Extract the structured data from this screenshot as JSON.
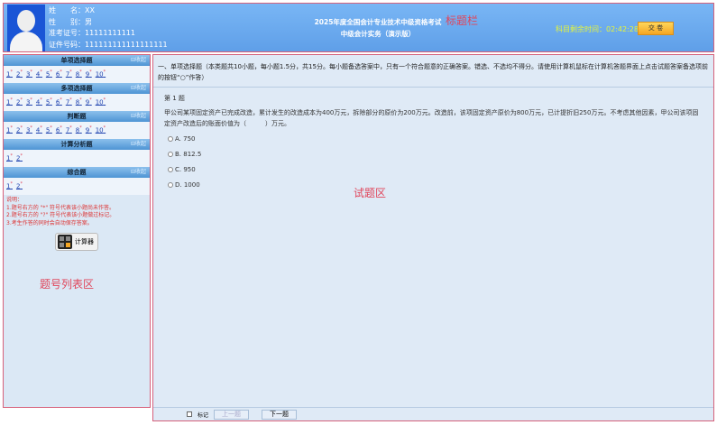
{
  "header": {
    "name_label": "姓　　名：",
    "name": "XX",
    "gender_label": "性　　别：",
    "gender": "男",
    "exam_no_label": "准考证号：",
    "exam_no": "11111111111",
    "id_label": "证件号码：",
    "id_no": "111111111111111111",
    "title1": "2025年度全国会计专业技术中级资格考试",
    "title2": "中级会计实务（演示版）",
    "region_tag": "标题栏",
    "timer_label": "科目剩余时间：",
    "timer": "02:42:28",
    "submit": "交 卷"
  },
  "sidebar": {
    "collapse": "收起",
    "sections": [
      {
        "title": "单项选择题",
        "items": [
          "1",
          "2",
          "3",
          "4",
          "5",
          "6",
          "7",
          "8",
          "9",
          "10"
        ]
      },
      {
        "title": "多项选择题",
        "items": [
          "1",
          "2",
          "3",
          "4",
          "5",
          "6",
          "7",
          "8",
          "9",
          "10"
        ]
      },
      {
        "title": "判断题",
        "items": [
          "1",
          "2",
          "3",
          "4",
          "5",
          "6",
          "7",
          "8",
          "9",
          "10"
        ]
      },
      {
        "title": "计算分析题",
        "items": [
          "1",
          "2"
        ]
      },
      {
        "title": "综合题",
        "items": [
          "1",
          "2"
        ]
      }
    ],
    "mark": "*",
    "notes": [
      "说明：",
      "1.题号右方的 \"*\" 符号代表该小题尚未作答。",
      "2.题号右方的 \"?\" 符号代表该小题做过标记。",
      "3.考生作答的同时会自动保存答案。"
    ],
    "calculator": "计算器",
    "region_tag": "题号列表区"
  },
  "main": {
    "instructions": "一、单项选择题（本类题共10小题，每小题1.5分，共15分。每小题备选答案中，只有一个符合题意的正确答案。错选、不选均不得分。请使用计算机鼠标在计算机答题界面上点击试题答案备选项前的按钮“○”作答）",
    "question_no": "第 1 题",
    "question": "甲公司某项固定资产已完成改造，累计发生的改造成本为400万元，拆除部分的原价为200万元。改造前，该项固定资产原价为800万元，已计提折旧250万元。不考虑其他因素，甲公司该项固定资产改造后的账面价值为（　　　）万元。",
    "options": [
      "A. 750",
      "B. 812.5",
      "C. 950",
      "D. 1000"
    ],
    "region_tag": "试题区",
    "mark_label": "标记",
    "prev": "上一题",
    "next": "下一题"
  }
}
